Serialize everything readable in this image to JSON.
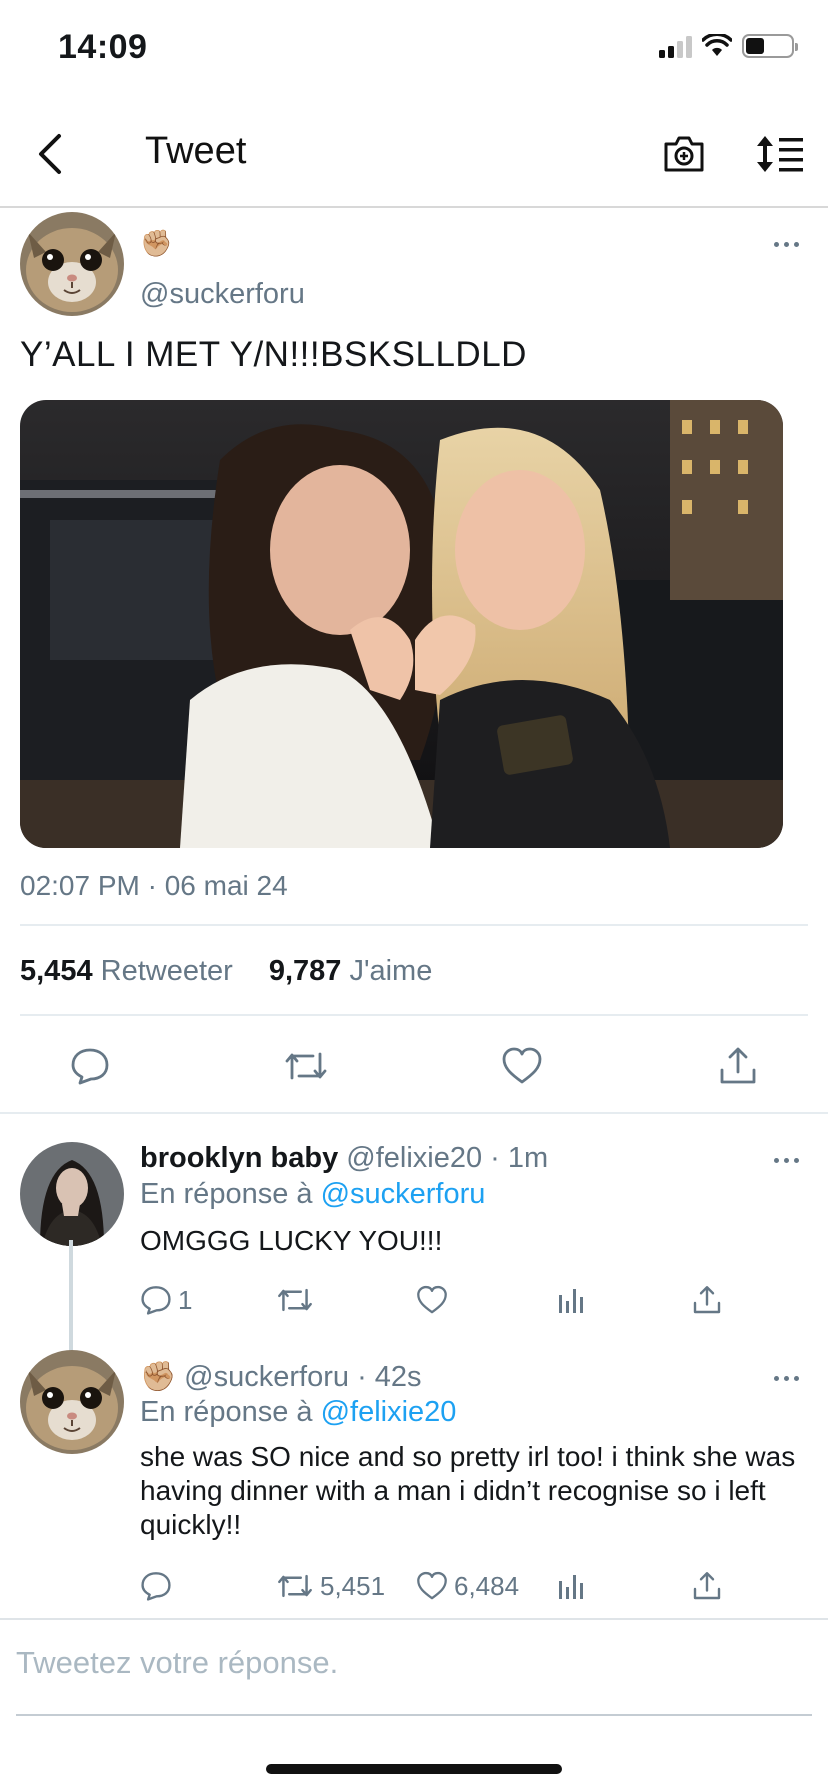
{
  "status_bar": {
    "time": "14:09"
  },
  "nav": {
    "title": "Tweet"
  },
  "main_tweet": {
    "author_emoji": "✊🏼",
    "handle": "@suckerforu",
    "text": "Y’ALL I MET Y/N!!!BSKSLLDLD",
    "timestamp": "02:07 PM · 06 mai 24",
    "retweets_count": "5,454",
    "retweets_label": "Retweeter",
    "likes_count": "9,787",
    "likes_label": "J'aime"
  },
  "replies": [
    {
      "display_name": "brooklyn baby",
      "handle": "@felixie20",
      "time": "· 1m",
      "reply_prefix": "En réponse à",
      "reply_to": "@suckerforu",
      "text": "OMGGG LUCKY YOU!!!",
      "reply_count": "1",
      "retweet_count": "",
      "like_count": ""
    },
    {
      "author_emoji": "✊🏼",
      "handle": "@suckerforu",
      "time": "· 42s",
      "reply_prefix": "En réponse à",
      "reply_to": "@felixie20",
      "text": "she was SO nice and so pretty irl too! i think she was having dinner with a man i didn’t recognise so i left quickly!!",
      "reply_count": "",
      "retweet_count": "5,451",
      "like_count": "6,484"
    }
  ],
  "compose": {
    "placeholder": "Tweetez votre réponse."
  },
  "colors": {
    "accent": "#1da1f2",
    "secondary_text": "#657786",
    "divider": "#e6ecf0"
  }
}
